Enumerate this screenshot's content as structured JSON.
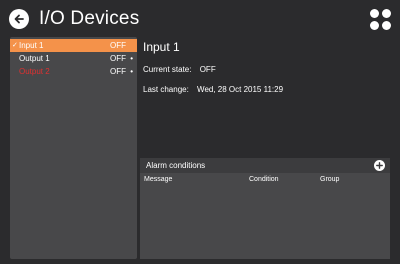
{
  "header": {
    "title": "I/O Devices",
    "back_icon": "back-arrow-icon",
    "apps_icon": "apps-dots-icon"
  },
  "device_list": {
    "items": [
      {
        "label": "Input 1",
        "state": "OFF",
        "selected": true,
        "has_bullet": false,
        "label_color": "#ffffff"
      },
      {
        "label": "Output 1",
        "state": "OFF",
        "selected": false,
        "has_bullet": true,
        "label_color": "#ffffff"
      },
      {
        "label": "Output 2",
        "state": "OFF",
        "selected": false,
        "has_bullet": true,
        "label_color": "#e03030"
      }
    ],
    "check_glyph": "✓",
    "bullet_glyph": "•"
  },
  "details": {
    "title": "Input 1",
    "current_state_label": "Current state:",
    "current_state_value": "OFF",
    "last_change_label": "Last change:",
    "last_change_value": "Wed, 28 Oct 2015 11:29"
  },
  "alarms": {
    "title": "Alarm conditions",
    "columns": [
      "Message",
      "Condition",
      "Group"
    ],
    "add_icon": "plus-icon"
  },
  "colors": {
    "background": "#2b2b2d",
    "panel": "#48484a",
    "selected": "#f4924a",
    "alert_text": "#e03030"
  }
}
